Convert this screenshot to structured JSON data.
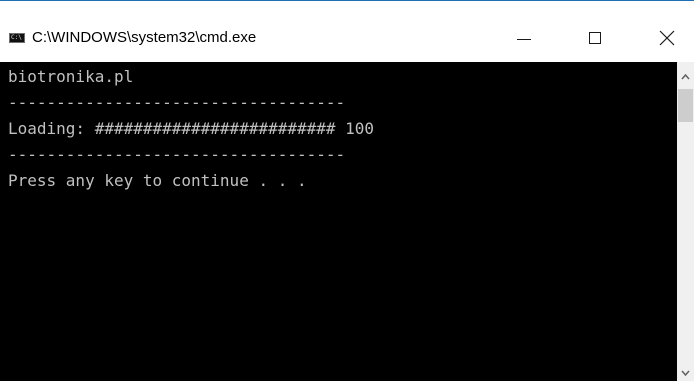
{
  "window": {
    "title": "C:\\WINDOWS\\system32\\cmd.exe",
    "icon": "cmd-console-icon",
    "icon_label": "C:\\"
  },
  "controls": {
    "minimize_icon": "minimize-icon",
    "maximize_icon": "maximize-icon",
    "close_icon": "close-icon"
  },
  "console": {
    "lines": [
      "biotronika.pl",
      "-----------------------------------",
      "Loading: ######################### 100",
      "-----------------------------------",
      "Press any key to continue . . ."
    ],
    "foreground": "#c0c0c0",
    "background": "#000000"
  },
  "scrollbar": {
    "up_icon": "scroll-up-arrow-icon",
    "down_icon": "scroll-down-arrow-icon"
  }
}
